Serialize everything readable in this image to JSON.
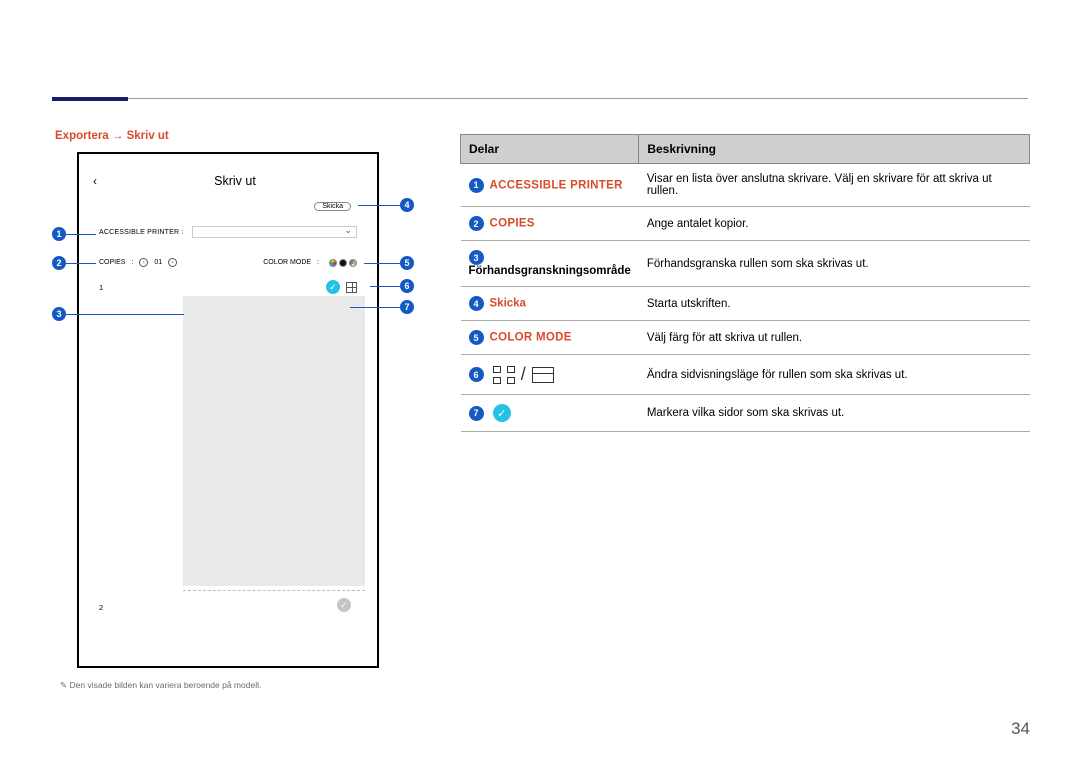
{
  "breadcrumb": "Exportera → Skriv ut",
  "phone": {
    "title": "Skriv ut",
    "send": "Skicka",
    "printer_label": "ACCESSIBLE PRINTER  :",
    "copies_label": "COPIES",
    "copies_value": "01",
    "colormode_label": "COLOR MODE",
    "page1": "1",
    "page2": "2"
  },
  "table": {
    "header_parts": "Delar",
    "header_desc": "Beskrivning",
    "rows": [
      {
        "num": "1",
        "label": "ACCESSIBLE PRINTER",
        "red": true,
        "desc": "Visar en lista över anslutna skrivare. Välj en skrivare för att skriva ut rullen."
      },
      {
        "num": "2",
        "label": "COPIES",
        "red": true,
        "desc": "Ange antalet kopior."
      },
      {
        "num": "3",
        "label": "Förhandsgranskningsområde",
        "red": false,
        "desc": "Förhandsgranska rullen som ska skrivas ut."
      },
      {
        "num": "4",
        "label": "Skicka",
        "red": true,
        "desc": "Starta utskriften."
      },
      {
        "num": "5",
        "label": "COLOR MODE",
        "red": true,
        "desc": "Välj färg för att skriva ut rullen."
      },
      {
        "num": "6",
        "label": "",
        "red": false,
        "desc": "Ändra sidvisningsläge för rullen som ska skrivas ut."
      },
      {
        "num": "7",
        "label": "",
        "red": false,
        "desc": "Markera vilka sidor som ska skrivas ut."
      }
    ]
  },
  "footnote": "Den visade bilden kan variera beroende på modell.",
  "pagenum": "34",
  "callouts": {
    "1": "1",
    "2": "2",
    "3": "3",
    "4": "4",
    "5": "5",
    "6": "6",
    "7": "7"
  }
}
